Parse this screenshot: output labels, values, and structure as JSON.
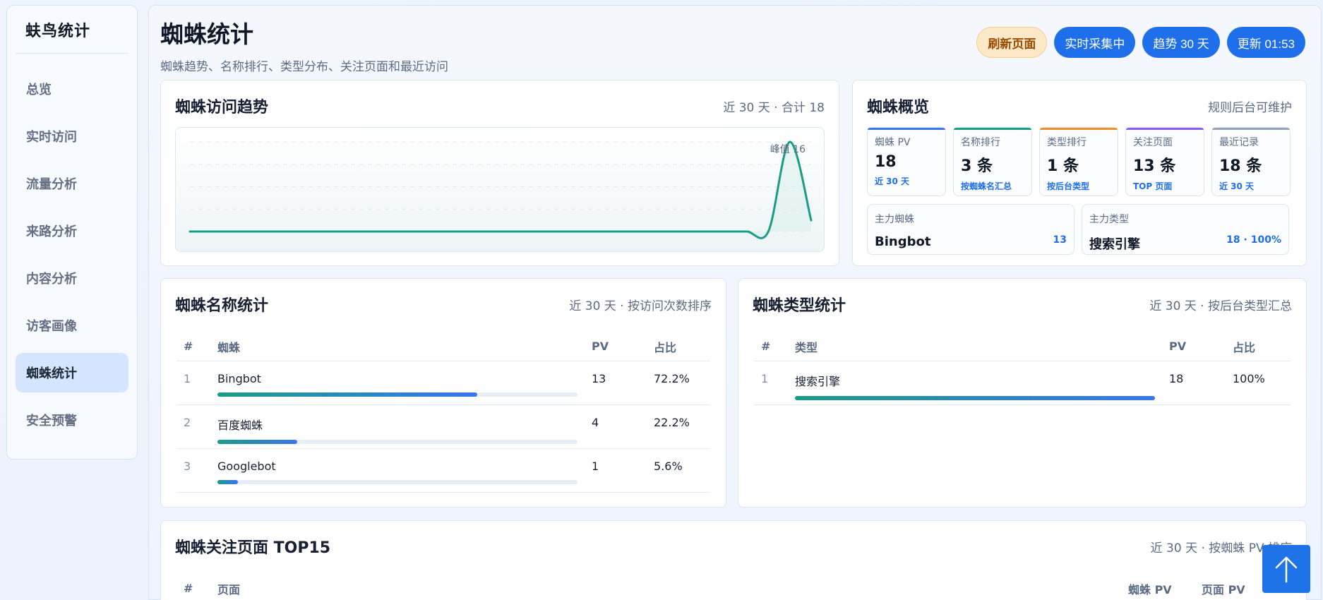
{
  "sidebar": {
    "brand": "蚨鸟统计",
    "items": [
      {
        "label": "总览",
        "active": false
      },
      {
        "label": "实时访问",
        "active": false
      },
      {
        "label": "流量分析",
        "active": false
      },
      {
        "label": "来路分析",
        "active": false
      },
      {
        "label": "内容分析",
        "active": false
      },
      {
        "label": "访客画像",
        "active": false
      },
      {
        "label": "蜘蛛统计",
        "active": true
      },
      {
        "label": "安全预警",
        "active": false
      }
    ]
  },
  "header": {
    "title": "蜘蛛统计",
    "subtitle": "蜘蛛趋势、名称排行、类型分布、关注页面和最近访问",
    "actions": {
      "refresh": "刷新页面",
      "realtime": "实时采集中",
      "trend": "趋势 30 天",
      "updated": "更新 01:53"
    }
  },
  "trend_card": {
    "title": "蜘蛛访问趋势",
    "meta": "近 30 天 · 合计 18",
    "peak_label": "峰值 16"
  },
  "chart_data": {
    "type": "area",
    "x": [
      1,
      2,
      3,
      4,
      5,
      6,
      7,
      8,
      9,
      10,
      11,
      12,
      13,
      14,
      15,
      16,
      17,
      18,
      19,
      20,
      21,
      22,
      23,
      24,
      25,
      26,
      27,
      28,
      29,
      30
    ],
    "series": [
      {
        "values": [
          0,
          0,
          0,
          0,
          0,
          0,
          0,
          0,
          0,
          0,
          0,
          0,
          0,
          0,
          0,
          0,
          0,
          0,
          0,
          0,
          0,
          0,
          0,
          0,
          0,
          0,
          0,
          0,
          16,
          2
        ]
      }
    ],
    "ylim": [
      0,
      16
    ],
    "grid": true,
    "colors": {
      "line": "#1b9c85",
      "fill": "#d6efe9"
    }
  },
  "overview_card": {
    "title": "蜘蛛概览",
    "meta": "规则后台可维护",
    "items": [
      {
        "label": "蜘蛛 PV",
        "value": "18",
        "note": "近 30 天",
        "color": "#3a76f0"
      },
      {
        "label": "名称排行",
        "value": "3 条",
        "note": "按蜘蛛名汇总",
        "color": "#1b9c85"
      },
      {
        "label": "类型排行",
        "value": "1 条",
        "note": "按后台类型",
        "color": "#f08c2a"
      },
      {
        "label": "关注页面",
        "value": "13 条",
        "note": "TOP 页面",
        "color": "#8b5cf6"
      },
      {
        "label": "最近记录",
        "value": "18 条",
        "note": "近 30 天",
        "color": "#94a3b8"
      }
    ],
    "main_spider": {
      "label": "主力蜘蛛",
      "value": "Bingbot",
      "note": "13"
    },
    "main_type": {
      "label": "主力类型",
      "value": "搜索引擎",
      "note": "18 · 100%"
    }
  },
  "name_card": {
    "title": "蜘蛛名称统计",
    "meta": "近 30 天 · 按访问次数排序",
    "headers": [
      "#",
      "蜘蛛",
      "PV",
      "占比"
    ],
    "rows": [
      {
        "rank": "1",
        "name": "Bingbot",
        "pv": "13",
        "share": "72.2%",
        "ratio": 0.722
      },
      {
        "rank": "2",
        "name": "百度蜘蛛",
        "pv": "4",
        "share": "22.2%",
        "ratio": 0.222
      },
      {
        "rank": "3",
        "name": "Googlebot",
        "pv": "1",
        "share": "5.6%",
        "ratio": 0.056
      }
    ]
  },
  "type_card": {
    "title": "蜘蛛类型统计",
    "meta": "近 30 天 · 按后台类型汇总",
    "headers": [
      "#",
      "类型",
      "PV",
      "占比"
    ],
    "rows": [
      {
        "rank": "1",
        "name": "搜索引擎",
        "pv": "18",
        "share": "100%",
        "ratio": 1.0
      }
    ]
  },
  "pages_card": {
    "title": "蜘蛛关注页面 TOP15",
    "meta": "近 30 天 · 按蜘蛛 PV 排序",
    "headers": [
      "#",
      "页面",
      "蜘蛛 PV",
      "页面 PV"
    ]
  }
}
